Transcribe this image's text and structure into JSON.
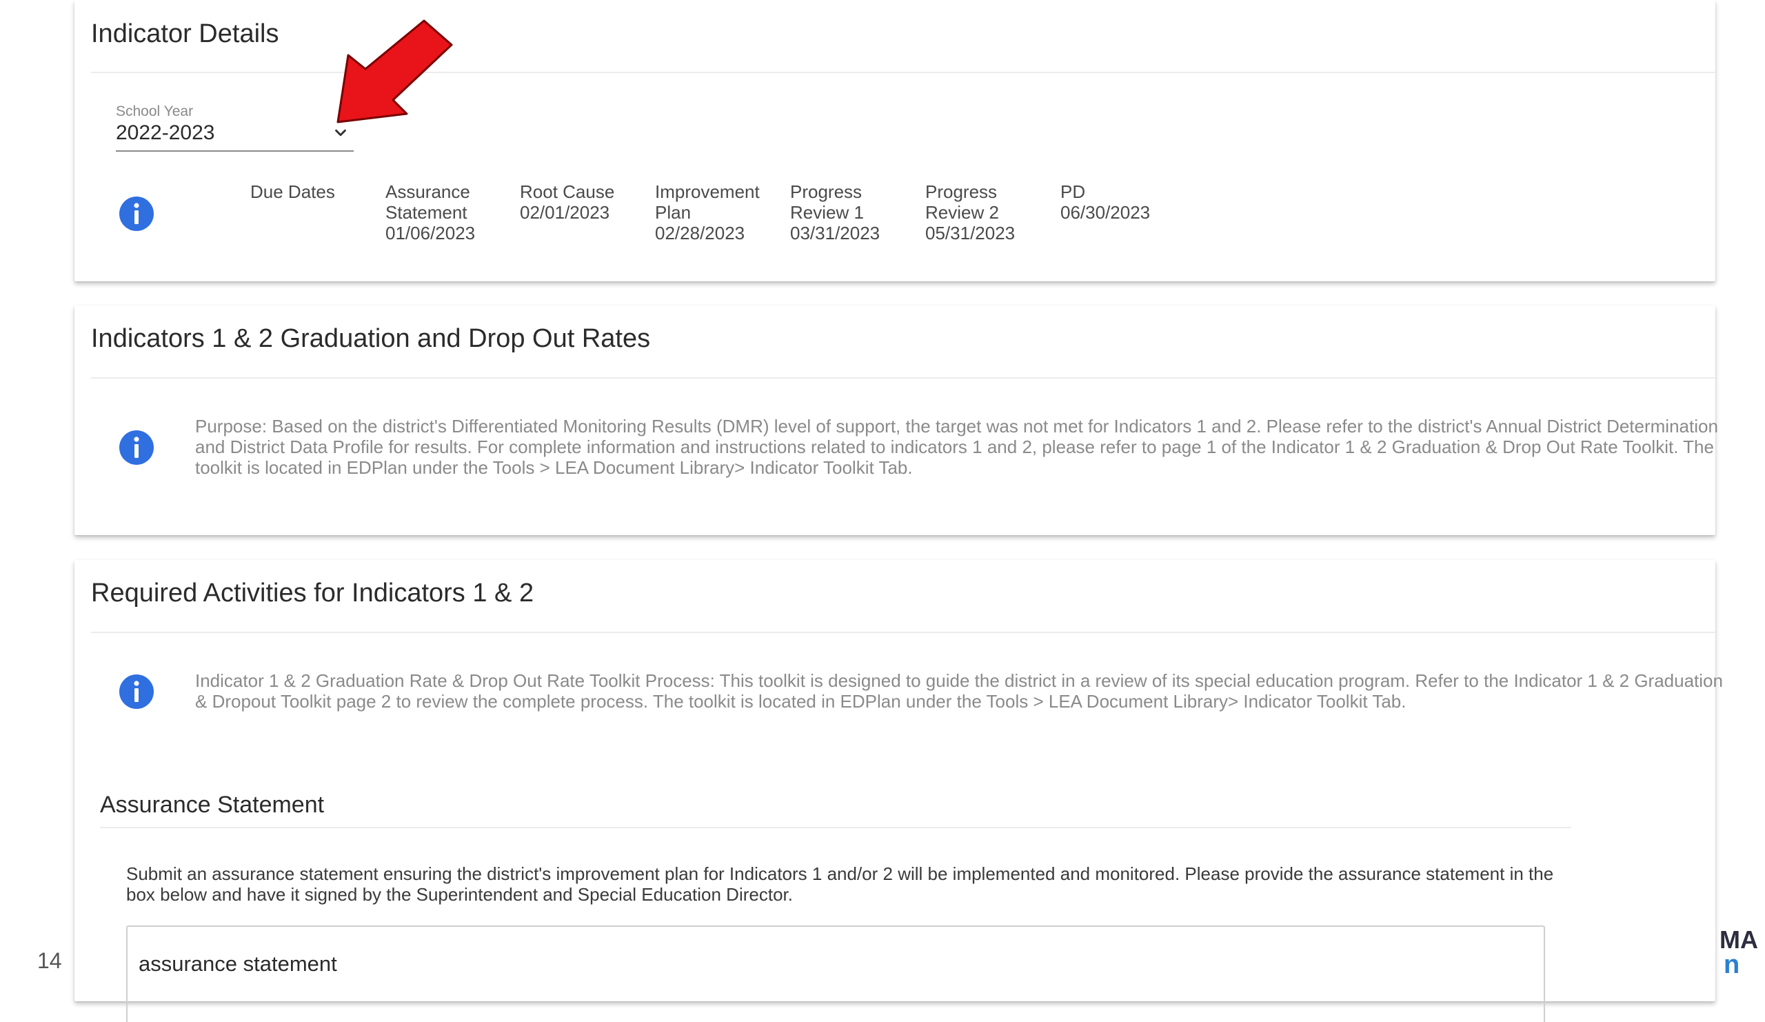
{
  "indicator_details": {
    "title": "Indicator Details",
    "school_year": {
      "label": "School Year",
      "value": "2022-2023"
    },
    "due_dates": [
      {
        "text": "Due Dates"
      },
      {
        "text": "Assurance\nStatement\n01/06/2023"
      },
      {
        "text": "Root Cause\n02/01/2023"
      },
      {
        "text": "Improvement\nPlan\n02/28/2023"
      },
      {
        "text": "Progress\nReview 1\n03/31/2023"
      },
      {
        "text": "Progress\nReview 2\n05/31/2023"
      },
      {
        "text": "PD\n06/30/2023"
      }
    ]
  },
  "graduation_card": {
    "title": "Indicators 1 & 2 Graduation and Drop Out Rates",
    "purpose": "Purpose: Based on the district's Differentiated Monitoring Results (DMR) level of support, the target was not met for Indicators 1 and 2. Please refer to the district's Annual District Determination and District Data Profile for results. For complete information and instructions related to indicators 1 and 2, please refer to page 1 of the Indicator 1 & 2 Graduation & Drop Out Rate Toolkit. The toolkit is located in EDPlan under the Tools > LEA Document Library> Indicator Toolkit Tab."
  },
  "required_activities": {
    "title": "Required Activities for Indicators 1 & 2",
    "toolkit_process": "Indicator 1 & 2 Graduation Rate & Drop Out Rate Toolkit Process: This toolkit is designed to guide the district in a review of its special education program. Refer to the Indicator 1 & 2 Graduation & Dropout Toolkit page 2 to review the complete process. The toolkit is located in EDPlan under the Tools > LEA Document Library> Indicator Toolkit Tab.",
    "assurance": {
      "heading": "Assurance Statement",
      "description": "Submit an assurance statement ensuring the district's improvement plan for Indicators 1 and/or 2 will be implemented and monitored. Please provide the assurance statement in the box below and have it signed by the Superintendent and Special Education Director.",
      "textbox_value": "assurance statement"
    }
  },
  "footer": {
    "page_number": "14",
    "brand_line1": "MA",
    "brand_line2": "n"
  },
  "colors": {
    "info_icon": "#2f6fe0",
    "arrow": "#e8141a",
    "brand_blue": "#2a7fd2"
  },
  "icons": {
    "info": "info-circle-icon",
    "chevron": "chevron-down-icon",
    "annotation": "red-arrow-icon"
  }
}
